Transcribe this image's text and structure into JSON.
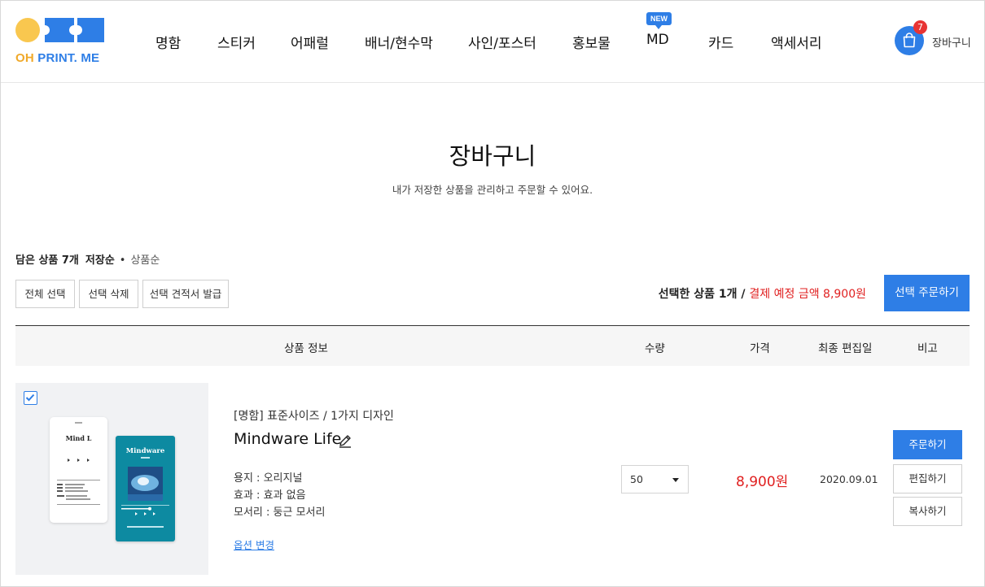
{
  "brand": {
    "logo_oh": "OH",
    "logo_rest": " PRINT. ME",
    "accent": "#2e7ee6",
    "dot_yellow": "#f9c74f"
  },
  "nav": {
    "items": [
      "명함",
      "스티커",
      "어패럴",
      "배너/현수막",
      "사인/포스터",
      "홍보물",
      "MD",
      "카드",
      "액세서리"
    ],
    "new_badge": "NEW"
  },
  "cart": {
    "count": "7",
    "label": "장바구니",
    "icon": "shopping-bag-icon"
  },
  "page": {
    "title": "장바구니",
    "subtitle": "내가 저장한 상품을 관리하고 주문할 수 있어요."
  },
  "summary": {
    "count": "담은 상품 7개",
    "sort_active": "저장순",
    "dot": "•",
    "sort_other": "상품순"
  },
  "actions": {
    "select_all": "전체 선택",
    "delete_selected": "선택 삭제",
    "quote_selected": "선택 견적서 발급",
    "order_selected": "선택 주문하기"
  },
  "selection": {
    "info": "선택한 상품 1개 / ",
    "amount": "결제 예정 금액 8,900원"
  },
  "table": {
    "headers": {
      "info": "상품 정보",
      "qty": "수량",
      "price": "가격",
      "date": "최종 편집일",
      "note": "비고"
    }
  },
  "item": {
    "checked": true,
    "category": "[명함] 표준사이즈 / 1가지 디자인",
    "name": "Mindware Life",
    "options": [
      "용지 : 오리지널",
      "효과 : 효과 없음",
      "모서리 : 둥근 모서리"
    ],
    "option_change": "옵션 변경",
    "quantity": "50",
    "price": "8,900원",
    "date": "2020.09.01",
    "buttons": {
      "order": "주문하기",
      "edit": "편집하기",
      "copy": "복사하기"
    },
    "preview": {
      "front_title": "Mind L",
      "back_title": "Mindware"
    }
  }
}
